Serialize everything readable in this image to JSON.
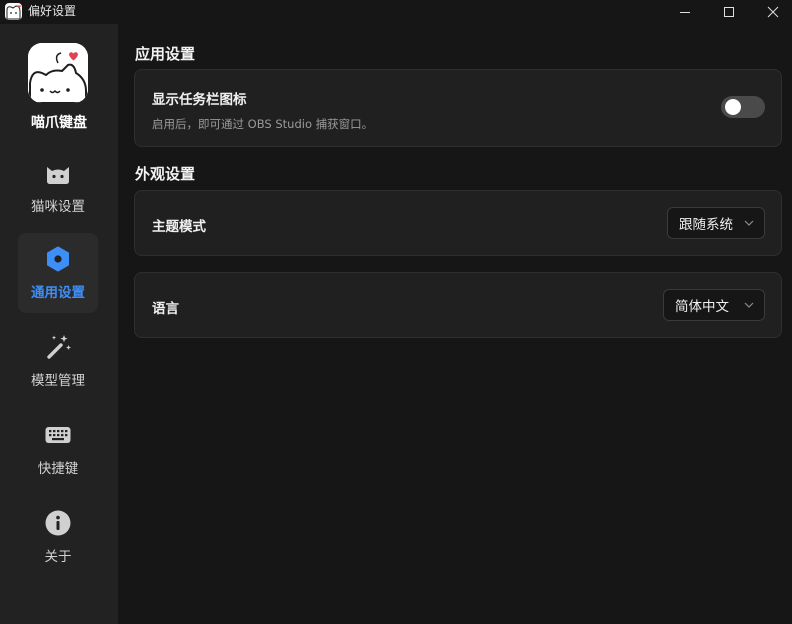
{
  "window": {
    "title": "偏好设置",
    "controls": {
      "minimize": "minimize-icon",
      "maximize": "maximize-icon",
      "close": "close-icon"
    }
  },
  "sidebar": {
    "app_name": "喵爪键盘",
    "items": [
      {
        "label": "猫咪设置",
        "icon": "cat-icon",
        "active": false
      },
      {
        "label": "通用设置",
        "icon": "hexagon-settings-icon",
        "active": true
      },
      {
        "label": "模型管理",
        "icon": "magic-wand-icon",
        "active": false
      },
      {
        "label": "快捷键",
        "icon": "keyboard-icon",
        "active": false
      },
      {
        "label": "关于",
        "icon": "info-icon",
        "active": false
      }
    ]
  },
  "sections": {
    "app": {
      "title": "应用设置",
      "taskbar_icon": {
        "title": "显示任务栏图标",
        "description": "启用后，即可通过 OBS Studio 捕获窗口。",
        "enabled": false
      }
    },
    "appearance": {
      "title": "外观设置",
      "theme": {
        "label": "主题模式",
        "value": "跟随系统"
      },
      "language": {
        "label": "语言",
        "value": "简体中文"
      }
    }
  },
  "colors": {
    "accent": "#3e8ef7",
    "background": "#161616",
    "sidebar": "#222222",
    "card": "#202020"
  }
}
